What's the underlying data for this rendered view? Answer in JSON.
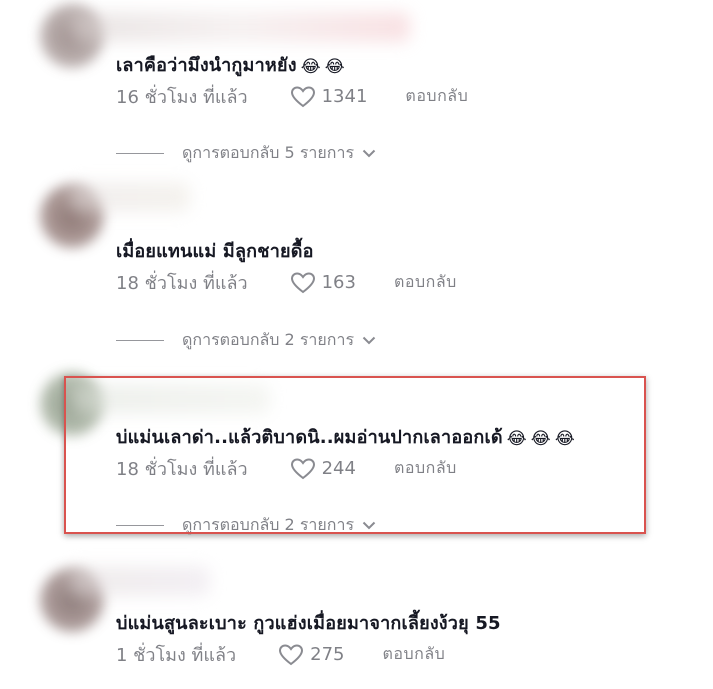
{
  "comments": [
    {
      "text": "เลาคือว่ามึงนำกูมาหยัง",
      "emojis": [
        "😂",
        "😂"
      ],
      "time": "16 ชั่วโมง ที่แล้ว",
      "likes": "1341",
      "reply_label": "ตอบกลับ",
      "view_replies": "ดูการตอบกลับ 5 รายการ"
    },
    {
      "text": "เมื่อยแทนแม่ มีลูกชายดื้อ",
      "emojis": [],
      "time": "18 ชั่วโมง ที่แล้ว",
      "likes": "163",
      "reply_label": "ตอบกลับ",
      "view_replies": "ดูการตอบกลับ 2 รายการ"
    },
    {
      "text": "บ่แม่นเลาด่า..แล้วติบาดนิ..ผมอ่านปากเลาออกเด้",
      "emojis": [
        "😂",
        "😂",
        "😂"
      ],
      "time": "18 ชั่วโมง ที่แล้ว",
      "likes": "244",
      "reply_label": "ตอบกลับ",
      "view_replies": "ดูการตอบกลับ 2 รายการ"
    },
    {
      "text": "บ่แม่นสูนละเบาะ กูวแฮ่งเมื่อยมาจากเลี้ยงง้วยุ 55",
      "emojis": [],
      "time": "1 ชั่วโมง ที่แล้ว",
      "likes": "275",
      "reply_label": "ตอบกลับ",
      "view_replies": ""
    }
  ],
  "icons": {
    "like": "heart-outline-icon",
    "expand": "chevron-down-icon"
  },
  "colors": {
    "highlight": "#d9534f",
    "text": "#161823",
    "muted": "#8a8b91"
  }
}
